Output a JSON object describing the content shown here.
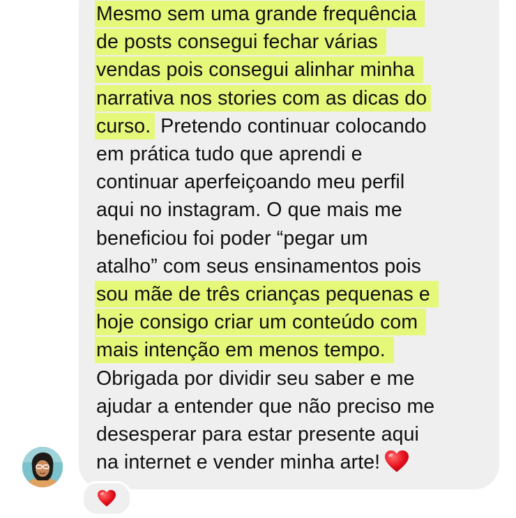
{
  "message": {
    "lines": [
      "Mesmo sem uma grande frequência",
      "de posts consegui fechar várias",
      "vendas pois consegui alinhar minha",
      "narrativa nos stories com as dicas do",
      "curso.",
      " Pretendo continuar colocando",
      "em prática tudo que aprendi e",
      "continuar aperfeiçoando meu perfil",
      "aqui no instagram. O que mais me",
      "beneficiou foi poder “pegar um",
      "atalho” com seus ensinamentos pois",
      "sou mãe de três crianças pequenas e",
      "hoje consigo criar um conteúdo com",
      "mais intenção em menos tempo.",
      "Obrigada por dividir seu saber e me",
      "ajudar a entender que não preciso me",
      "desesperar para estar presente aqui",
      "na internet e vender minha arte!"
    ],
    "end_emoji": "red-heart-emoji",
    "highlight_color": "#e5f87a",
    "bubble_color": "#efefef",
    "text_color": "#0f0f0f"
  },
  "sender": {
    "avatar_icon": "user-avatar"
  },
  "reaction": {
    "emoji_icon": "red-heart-icon"
  }
}
